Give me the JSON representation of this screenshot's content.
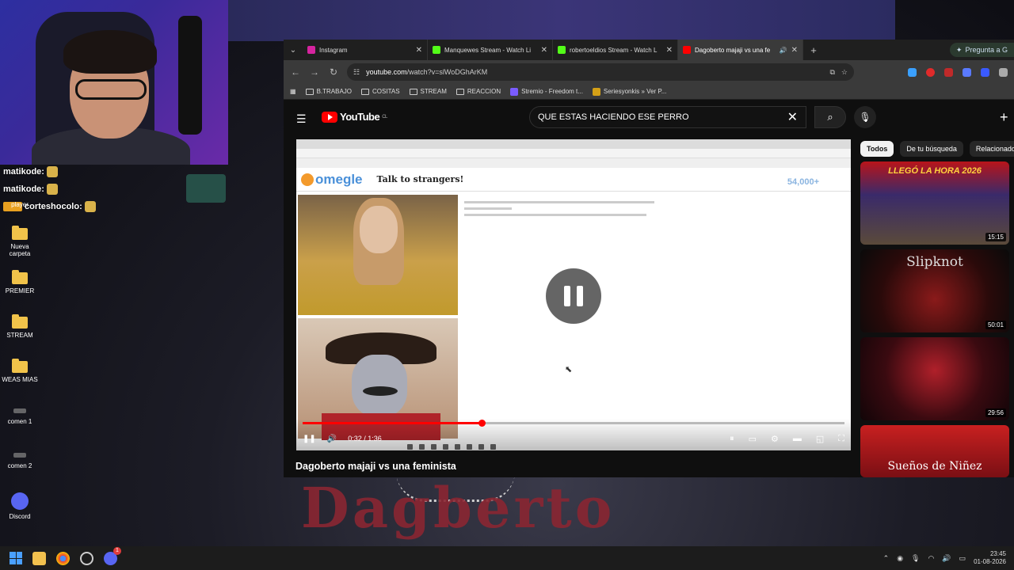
{
  "background": {
    "shirt_text": "Dagberto"
  },
  "chat": [
    {
      "user": "matikode:"
    },
    {
      "user": "matikode:"
    },
    {
      "user": "corteshocolo:"
    }
  ],
  "desktop_icons": [
    {
      "label": "player",
      "type": "app"
    },
    {
      "label": "Nueva carpeta",
      "type": "folder"
    },
    {
      "label": "PREMIER",
      "type": "folder"
    },
    {
      "label": "STREAM",
      "type": "folder"
    },
    {
      "label": "WEAS MIAS",
      "type": "folder"
    },
    {
      "label": "comen 1",
      "type": "file"
    },
    {
      "label": "comen 2",
      "type": "file"
    },
    {
      "label": "Discord",
      "type": "app"
    }
  ],
  "browser": {
    "tabs": [
      {
        "title": "Instagram",
        "color": "#d6249f"
      },
      {
        "title": "Manquewes Stream - Watch Li",
        "color": "#53fc18"
      },
      {
        "title": "robertoeldios Stream - Watch L",
        "color": "#53fc18"
      },
      {
        "title": "Dagoberto majaji vs una fe",
        "color": "#ff0000",
        "active": true
      }
    ],
    "gemini_label": "Pregunta a G",
    "url_domain": "youtube.com",
    "url_path": "/watch?v=slWoDGhArKM",
    "bookmarks": [
      "B.TRABAJO",
      "COSITAS",
      "STREAM",
      "REACCION",
      "Stremio - Freedom t...",
      "Seriesyonkis » Ver P..."
    ]
  },
  "youtube": {
    "logo_text": "YouTube",
    "country_code": "CL",
    "search_query": "QUE ESTAS HACIENDO ESE PERRO",
    "video_title": "Dagoberto majaji vs una feminista",
    "player": {
      "current_time": "0:32",
      "duration": "1:36",
      "progress_fraction": 0.33,
      "omegle_logo": "omegle",
      "omegle_tagline": "Talk to strangers!",
      "online_count": "54,000+"
    },
    "chips": [
      "Todos",
      "De tu búsqueda",
      "Relacionado"
    ],
    "recommendations": [
      {
        "overlay_text": "LLEGÓ LA HORA 2026",
        "duration": "15:15"
      },
      {
        "overlay_text": "Slipknot",
        "duration": "50:01"
      },
      {
        "overlay_text": "",
        "duration": "29:56"
      },
      {
        "overlay_text": "Sueños de Niñez",
        "duration": ""
      }
    ]
  },
  "taskbar": {
    "time": "23:45",
    "date": "01-08-2026",
    "notification_count": "1"
  }
}
